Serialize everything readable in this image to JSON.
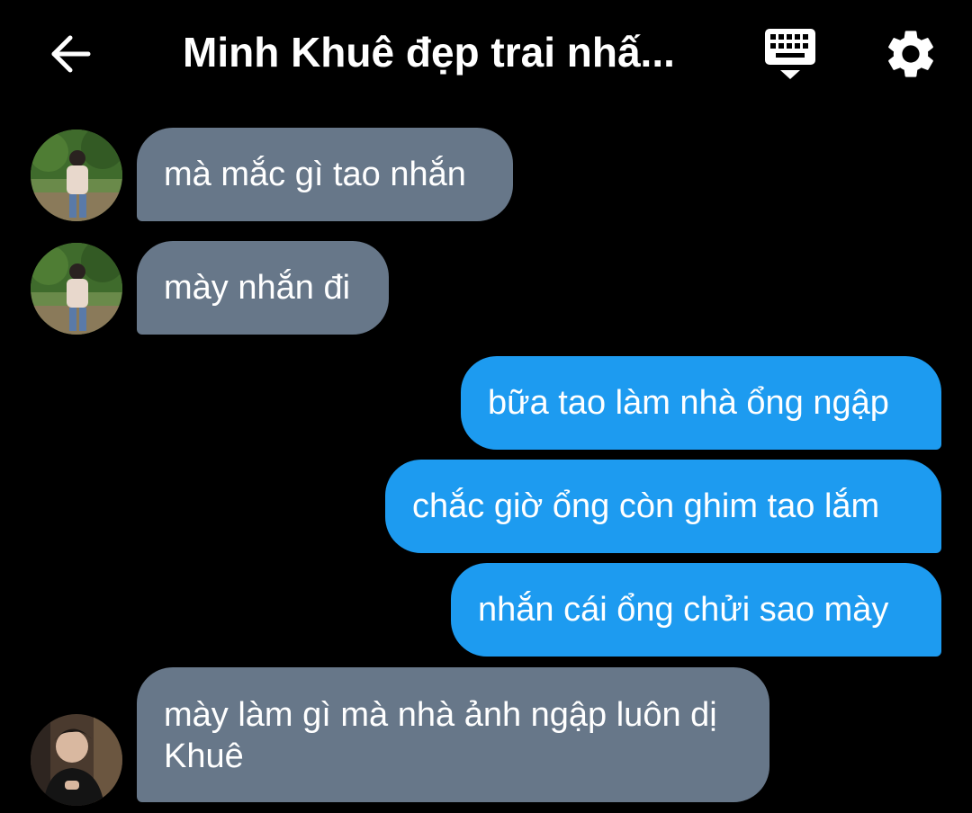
{
  "header": {
    "back_icon": "arrow-left-icon",
    "title": "Minh Khuê đẹp trai nhấ...",
    "keyboard_icon": "keyboard-icon",
    "settings_icon": "gear-icon"
  },
  "colors": {
    "background": "#000000",
    "incoming_bubble": "#677789",
    "outgoing_bubble": "#1d9bf0",
    "text": "#ffffff"
  },
  "messages": [
    {
      "direction": "incoming",
      "text": "mà mắc gì tao nhắn",
      "avatar": "avatar-outdoor-photo"
    },
    {
      "direction": "incoming",
      "text": "mày nhắn đi",
      "avatar": "avatar-outdoor-photo"
    },
    {
      "direction": "outgoing",
      "text": "bữa tao làm nhà ổng ngập"
    },
    {
      "direction": "outgoing",
      "text": "chắc giờ ổng còn ghim tao lắm"
    },
    {
      "direction": "outgoing",
      "text": "nhắn cái ổng chửi sao mày"
    },
    {
      "direction": "incoming",
      "text": "mày làm gì mà nhà ảnh ngập luôn dị Khuê",
      "avatar": "avatar-indoor-photo"
    }
  ]
}
